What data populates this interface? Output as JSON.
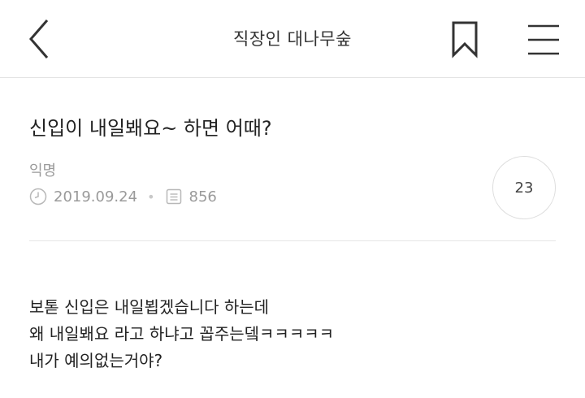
{
  "header": {
    "title": "직장인 대나무숲"
  },
  "post": {
    "title": "신입이 내일봬요~ 하면 어때?",
    "author": "익명",
    "date": "2019.09.24",
    "views": "856",
    "comment_count": "23",
    "separator": "•",
    "body_lines": [
      "보톧 신입은 내일뵙겠습니다 하는데",
      "왜 내일봬요 라고 하냐고 꼽주는뎈ㅋㅋㅋㅋㅋ",
      "내가 예의없는거야?"
    ]
  },
  "icons": {
    "back": "chevron-left-icon",
    "bookmark": "bookmark-icon",
    "menu": "hamburger-menu-icon",
    "clock": "clock-icon",
    "views": "document-icon"
  }
}
